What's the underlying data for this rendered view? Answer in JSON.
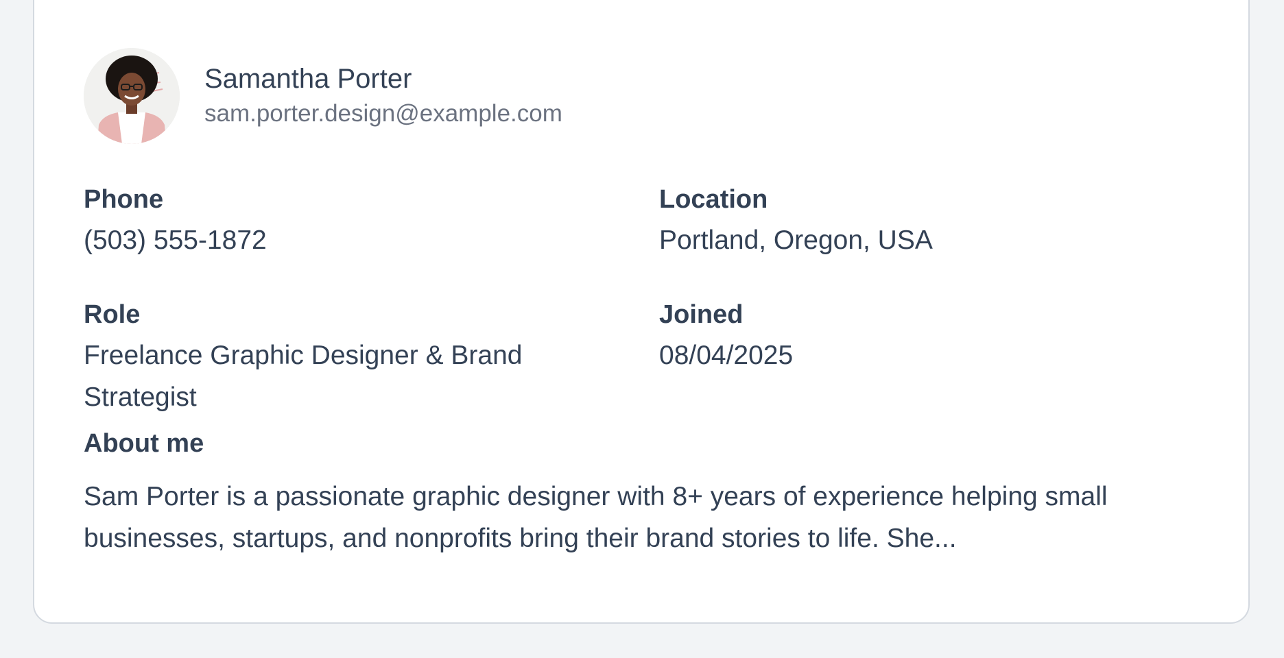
{
  "profile": {
    "name": "Samantha Porter",
    "email": "sam.porter.design@example.com",
    "avatar_icon": "avatar-photo"
  },
  "fields": {
    "phone": {
      "label": "Phone",
      "value": "(503) 555-1872"
    },
    "location": {
      "label": "Location",
      "value": "Portland, Oregon, USA"
    },
    "role": {
      "label": "Role",
      "value": "Freelance Graphic Designer & Brand Strategist"
    },
    "joined": {
      "label": "Joined",
      "value": "08/04/2025"
    }
  },
  "about": {
    "label": "About me",
    "text": "Sam Porter is a passionate graphic designer with 8+ years of experience helping small businesses, startups, and nonprofits bring their brand stories to life. She..."
  },
  "colors": {
    "page_background": "#f2f4f6",
    "card_background": "#ffffff",
    "card_border": "#d4d9e0",
    "primary_text": "#334155",
    "secondary_text": "#6b7280"
  }
}
